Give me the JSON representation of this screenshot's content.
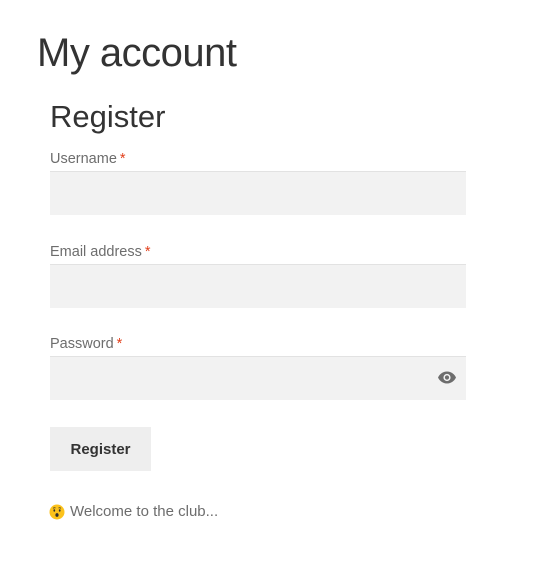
{
  "page": {
    "title": "My account"
  },
  "register_form": {
    "heading": "Register",
    "required_marker": "*",
    "fields": [
      {
        "label": "Username",
        "value": "",
        "type": "text"
      },
      {
        "label": "Email address",
        "value": "",
        "type": "email"
      },
      {
        "label": "Password",
        "value": "",
        "type": "password"
      }
    ],
    "password_toggle_icon": "eye-icon",
    "submit_label": "Register"
  },
  "welcome": {
    "emoji_icon": "hushed-face-icon",
    "text": "Welcome to the club..."
  },
  "colors": {
    "required": "#e2401c",
    "input_bg": "#f2f2f2",
    "button_bg": "#eeeeee",
    "label": "#6d6d6d"
  }
}
